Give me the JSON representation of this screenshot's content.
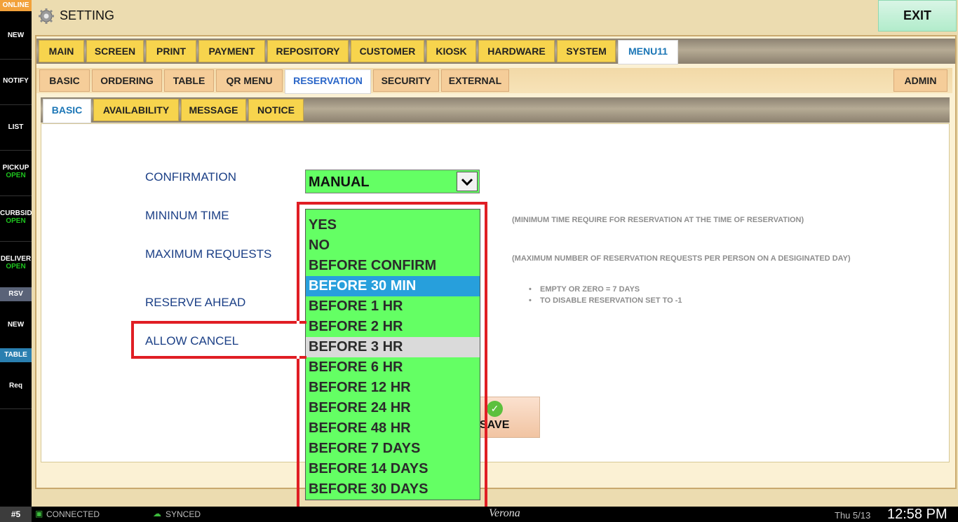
{
  "sidebar": {
    "online": "ONLINE",
    "new": "NEW",
    "notify": "NOTIFY",
    "list": "LIST",
    "pickup": "PICKUP",
    "pickup_status": "OPEN",
    "curbside": "CURBSID",
    "curbside_status": "OPEN",
    "delivery": "DELIVER",
    "delivery_status": "OPEN",
    "rsv": "RSV",
    "new2": "NEW",
    "table": "TABLE",
    "req": "Req"
  },
  "header": {
    "title": "SETTING",
    "exit_label": "EXIT"
  },
  "tabs_level1": [
    "MAIN",
    "SCREEN",
    "PRINT",
    "PAYMENT",
    "REPOSITORY",
    "CUSTOMER",
    "KIOSK",
    "HARDWARE",
    "SYSTEM",
    "MENU11"
  ],
  "tabs_level2": [
    "BASIC",
    "ORDERING",
    "TABLE",
    "QR MENU",
    "RESERVATION",
    "SECURITY",
    "EXTERNAL"
  ],
  "admin_tab": "ADMIN",
  "tabs_level3": [
    "BASIC",
    "AVAILABILITY",
    "MESSAGE",
    "NOTICE"
  ],
  "form": {
    "confirmation_label": "CONFIRMATION",
    "confirmation_value": "MANUAL",
    "min_time_label": "MININUM TIME",
    "min_time_hint": "(MINIMUM TIME REQUIRE FOR RESERVATION AT THE TIME OF RESERVATION)",
    "max_requests_label": "MAXIMUM REQUESTS",
    "max_requests_hint": "(MAXIMUM NUMBER OF RESERVATION REQUESTS PER PERSON ON A DESIGINATED DAY)",
    "reserve_ahead_label": "RESERVE AHEAD",
    "reserve_ahead_hints": [
      "EMPTY OR ZERO = 7 DAYS",
      "TO DISABLE RESERVATION SET TO -1"
    ],
    "allow_cancel_label": "ALLOW CANCEL",
    "save_label": "SAVE"
  },
  "dropdown_options": [
    "YES",
    "NO",
    "BEFORE CONFIRM",
    "BEFORE 30 MIN",
    "BEFORE 1 HR",
    "BEFORE 2 HR",
    "BEFORE 3 HR",
    "BEFORE 6 HR",
    "BEFORE 12 HR",
    "BEFORE 24 HR",
    "BEFORE 48 HR",
    "BEFORE 7 DAYS",
    "BEFORE 14 DAYS",
    "BEFORE 30 DAYS"
  ],
  "dropdown_selected": "BEFORE 30 MIN",
  "dropdown_hovered": "BEFORE 3 HR",
  "status": {
    "station": "#5",
    "connected": "CONNECTED",
    "synced": "SYNCED",
    "brand": "Verona",
    "date": "Thu 5/13",
    "time": "12:58 PM"
  },
  "colors": {
    "accent_green": "#64ff64",
    "selected_blue": "#279fdc",
    "highlight_red": "#e01e24",
    "tab_yellow": "#f7d44d"
  }
}
